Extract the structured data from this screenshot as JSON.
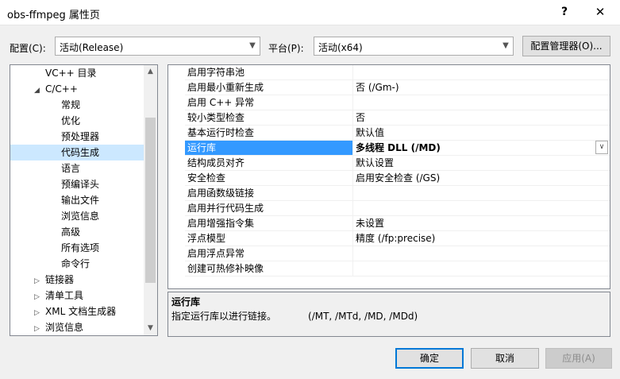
{
  "window": {
    "title": "obs-ffmpeg 属性页",
    "help_label": "?",
    "close_label": "✕"
  },
  "header": {
    "config_label": "配置(C):",
    "config_value": "活动(Release)",
    "platform_label": "平台(P):",
    "platform_value": "活动(x64)",
    "config_manager_label": "配置管理器(O)..."
  },
  "tree": {
    "items": [
      {
        "label": "VC++ 目录"
      },
      {
        "label": "C/C++",
        "toggle": "◢"
      },
      {
        "label": "常规"
      },
      {
        "label": "优化"
      },
      {
        "label": "预处理器"
      },
      {
        "label": "代码生成"
      },
      {
        "label": "语言"
      },
      {
        "label": "预编译头"
      },
      {
        "label": "输出文件"
      },
      {
        "label": "浏览信息"
      },
      {
        "label": "高级"
      },
      {
        "label": "所有选项"
      },
      {
        "label": "命令行"
      },
      {
        "label": "链接器",
        "toggle": "▷"
      },
      {
        "label": "清单工具",
        "toggle": "▷"
      },
      {
        "label": "XML 文档生成器",
        "toggle": "▷"
      },
      {
        "label": "浏览信息",
        "toggle": "▷"
      }
    ]
  },
  "properties": [
    {
      "name": "启用字符串池",
      "value": ""
    },
    {
      "name": "启用最小重新生成",
      "value": "否 (/Gm-)"
    },
    {
      "name": "启用 C++ 异常",
      "value": ""
    },
    {
      "name": "较小类型检查",
      "value": "否"
    },
    {
      "name": "基本运行时检查",
      "value": "默认值"
    },
    {
      "name": "运行库",
      "value": "多线程 DLL (/MD)"
    },
    {
      "name": "结构成员对齐",
      "value": "默认设置"
    },
    {
      "name": "安全检查",
      "value": "启用安全检查 (/GS)"
    },
    {
      "name": "启用函数级链接",
      "value": ""
    },
    {
      "name": "启用并行代码生成",
      "value": ""
    },
    {
      "name": "启用增强指令集",
      "value": "未设置"
    },
    {
      "name": "浮点模型",
      "value": "精度 (/fp:precise)"
    },
    {
      "name": "启用浮点异常",
      "value": ""
    },
    {
      "name": "创建可热修补映像",
      "value": ""
    }
  ],
  "description": {
    "title": "运行库",
    "text": "指定运行库以进行链接。",
    "options": "(/MT, /MTd, /MD, /MDd)"
  },
  "footer": {
    "ok_label": "确定",
    "cancel_label": "取消",
    "apply_label": "应用(A)"
  }
}
